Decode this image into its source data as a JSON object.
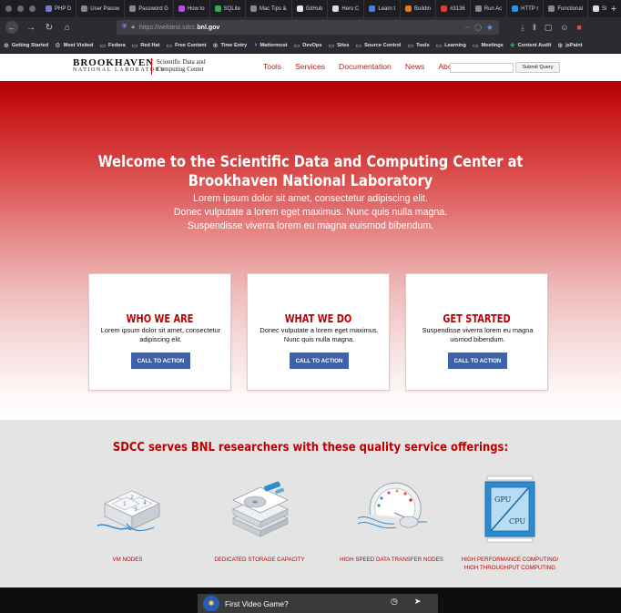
{
  "browser": {
    "tabs": [
      {
        "label": "PHP D",
        "icon_color": "#6f7cc4"
      },
      {
        "label": "User Passw",
        "icon_color": "#888888"
      },
      {
        "label": "Password G",
        "icon_color": "#888888"
      },
      {
        "label": "How to",
        "icon_color": "#b44de0"
      },
      {
        "label": "SQLite",
        "icon_color": "#33aa55"
      },
      {
        "label": "Mac Tips &",
        "icon_color": "#888888"
      },
      {
        "label": "GitHub",
        "icon_color": "#e8e8e8"
      },
      {
        "label": "Hero C",
        "icon_color": "#dddddd"
      },
      {
        "label": "Learn t",
        "icon_color": "#4a7fd8"
      },
      {
        "label": "Buildin",
        "icon_color": "#e8781e"
      },
      {
        "label": "#3136",
        "icon_color": "#d83c3c"
      },
      {
        "label": "Run Ac",
        "icon_color": "#888888"
      },
      {
        "label": "HTTP r",
        "icon_color": "#2d8fe0"
      },
      {
        "label": "Functional",
        "icon_color": "#888888"
      },
      {
        "label": "SDCC",
        "icon_color": "#dddddd"
      },
      {
        "label": "Welcom",
        "icon_color": "#ffffff",
        "active": true
      }
    ],
    "new_tab_label": "+",
    "url_prefix": "https://webtest.sdcc.",
    "url_host": "bnl.gov",
    "url_actions": "⋯",
    "bookmarks": [
      {
        "label": "Getting Started",
        "icon": "globe-icon"
      },
      {
        "label": "Most Visited",
        "icon": "gear-icon"
      },
      {
        "label": "Fedora",
        "icon": "folder-icon"
      },
      {
        "label": "Red Hat",
        "icon": "folder-icon"
      },
      {
        "label": "Free Content",
        "icon": "folder-icon"
      },
      {
        "label": "Time Entry",
        "icon": "globe-icon"
      },
      {
        "label": "Mattermost",
        "icon": "mattermost-icon"
      },
      {
        "label": "DevOps",
        "icon": "folder-icon"
      },
      {
        "label": "Sites",
        "icon": "folder-icon"
      },
      {
        "label": "Source Control",
        "icon": "folder-icon"
      },
      {
        "label": "Tools",
        "icon": "folder-icon"
      },
      {
        "label": "Learning",
        "icon": "folder-icon"
      },
      {
        "label": "Meetings",
        "icon": "folder-icon"
      },
      {
        "label": "Content Audit",
        "icon": "plus-icon"
      },
      {
        "label": "jsPaint",
        "icon": "globe-icon"
      }
    ]
  },
  "site": {
    "logo_main": "BROOKHAVEN",
    "logo_sub": "NATIONAL LABORATORY",
    "logo_tag_line1": "Scientific Data and",
    "logo_tag_line2": "Computing Center",
    "menu": [
      "Tools",
      "Services",
      "Documentation",
      "News",
      "About Us"
    ],
    "search_placeholder": "",
    "search_button": "Submit Query"
  },
  "hero": {
    "title_line1": "Welcome to the Scientific Data and Computing Center at",
    "title_line2": "Brookhaven National Laboratory",
    "sub_line1": "Lorem ipsum dolor sit amet, consectetur adipiscing elit.",
    "sub_line2": "Donec vulputate a lorem eget maximus. Nunc quis nulla magna.",
    "sub_line3": "Suspendisse viverra lorem eu magna euismod bibendum."
  },
  "cards": [
    {
      "title": "WHO WE ARE",
      "text": "Lorem ipsum dolor sit amet, consectetur adipiscing elit.",
      "button": "CALL TO ACTION"
    },
    {
      "title": "WHAT WE DO",
      "text": "Donec vulputate a lorem eget maximus. Nunc quis nulla magna.",
      "button": "CALL TO ACTION"
    },
    {
      "title": "GET STARTED",
      "text": "Suspendisse viverra lorem eu magna uismod bibendum.",
      "button": "CALL TO ACTION"
    }
  ],
  "services": {
    "title": "SDCC serves BNL researchers with these quality service offerings:",
    "items": [
      {
        "label_line1": "VM NODES",
        "label_line2": "",
        "icon": "vm-nodes-icon"
      },
      {
        "label_line1": "DEDICATED STORAGE CAPACITY",
        "label_line2": "",
        "icon": "storage-icon"
      },
      {
        "label_line1": "HIGH SPEED DATA TRANSFER NODES",
        "label_line2": "",
        "icon": "speedometer-icon"
      },
      {
        "label_line1": "HIGH PERFORMANCE COMPUTING/",
        "label_line2": "HIGH THROUGHPUT COMPUTING",
        "icon": "gpu-cpu-icon"
      }
    ],
    "gpu_label": "GPU",
    "cpu_label": "CPU"
  },
  "video": {
    "title": "First Video Game?"
  },
  "colors": {
    "brand_red": "#c00000",
    "button_blue": "#3d62a8"
  }
}
